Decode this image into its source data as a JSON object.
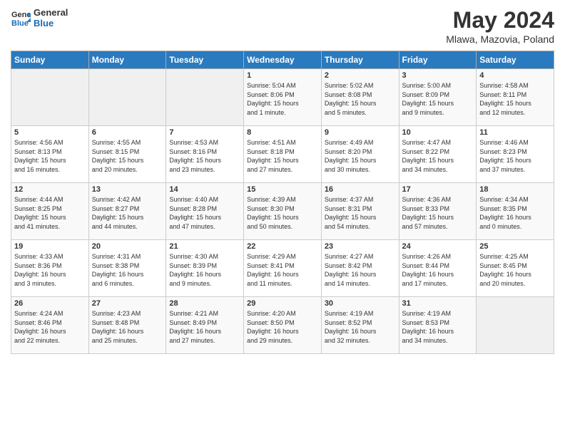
{
  "logo": {
    "line1": "General",
    "line2": "Blue"
  },
  "title": "May 2024",
  "subtitle": "Mlawa, Mazovia, Poland",
  "days_header": [
    "Sunday",
    "Monday",
    "Tuesday",
    "Wednesday",
    "Thursday",
    "Friday",
    "Saturday"
  ],
  "weeks": [
    [
      {
        "day": "",
        "info": ""
      },
      {
        "day": "",
        "info": ""
      },
      {
        "day": "",
        "info": ""
      },
      {
        "day": "1",
        "info": "Sunrise: 5:04 AM\nSunset: 8:06 PM\nDaylight: 15 hours\nand 1 minute."
      },
      {
        "day": "2",
        "info": "Sunrise: 5:02 AM\nSunset: 8:08 PM\nDaylight: 15 hours\nand 5 minutes."
      },
      {
        "day": "3",
        "info": "Sunrise: 5:00 AM\nSunset: 8:09 PM\nDaylight: 15 hours\nand 9 minutes."
      },
      {
        "day": "4",
        "info": "Sunrise: 4:58 AM\nSunset: 8:11 PM\nDaylight: 15 hours\nand 12 minutes."
      }
    ],
    [
      {
        "day": "5",
        "info": "Sunrise: 4:56 AM\nSunset: 8:13 PM\nDaylight: 15 hours\nand 16 minutes."
      },
      {
        "day": "6",
        "info": "Sunrise: 4:55 AM\nSunset: 8:15 PM\nDaylight: 15 hours\nand 20 minutes."
      },
      {
        "day": "7",
        "info": "Sunrise: 4:53 AM\nSunset: 8:16 PM\nDaylight: 15 hours\nand 23 minutes."
      },
      {
        "day": "8",
        "info": "Sunrise: 4:51 AM\nSunset: 8:18 PM\nDaylight: 15 hours\nand 27 minutes."
      },
      {
        "day": "9",
        "info": "Sunrise: 4:49 AM\nSunset: 8:20 PM\nDaylight: 15 hours\nand 30 minutes."
      },
      {
        "day": "10",
        "info": "Sunrise: 4:47 AM\nSunset: 8:22 PM\nDaylight: 15 hours\nand 34 minutes."
      },
      {
        "day": "11",
        "info": "Sunrise: 4:46 AM\nSunset: 8:23 PM\nDaylight: 15 hours\nand 37 minutes."
      }
    ],
    [
      {
        "day": "12",
        "info": "Sunrise: 4:44 AM\nSunset: 8:25 PM\nDaylight: 15 hours\nand 41 minutes."
      },
      {
        "day": "13",
        "info": "Sunrise: 4:42 AM\nSunset: 8:27 PM\nDaylight: 15 hours\nand 44 minutes."
      },
      {
        "day": "14",
        "info": "Sunrise: 4:40 AM\nSunset: 8:28 PM\nDaylight: 15 hours\nand 47 minutes."
      },
      {
        "day": "15",
        "info": "Sunrise: 4:39 AM\nSunset: 8:30 PM\nDaylight: 15 hours\nand 50 minutes."
      },
      {
        "day": "16",
        "info": "Sunrise: 4:37 AM\nSunset: 8:31 PM\nDaylight: 15 hours\nand 54 minutes."
      },
      {
        "day": "17",
        "info": "Sunrise: 4:36 AM\nSunset: 8:33 PM\nDaylight: 15 hours\nand 57 minutes."
      },
      {
        "day": "18",
        "info": "Sunrise: 4:34 AM\nSunset: 8:35 PM\nDaylight: 16 hours\nand 0 minutes."
      }
    ],
    [
      {
        "day": "19",
        "info": "Sunrise: 4:33 AM\nSunset: 8:36 PM\nDaylight: 16 hours\nand 3 minutes."
      },
      {
        "day": "20",
        "info": "Sunrise: 4:31 AM\nSunset: 8:38 PM\nDaylight: 16 hours\nand 6 minutes."
      },
      {
        "day": "21",
        "info": "Sunrise: 4:30 AM\nSunset: 8:39 PM\nDaylight: 16 hours\nand 9 minutes."
      },
      {
        "day": "22",
        "info": "Sunrise: 4:29 AM\nSunset: 8:41 PM\nDaylight: 16 hours\nand 11 minutes."
      },
      {
        "day": "23",
        "info": "Sunrise: 4:27 AM\nSunset: 8:42 PM\nDaylight: 16 hours\nand 14 minutes."
      },
      {
        "day": "24",
        "info": "Sunrise: 4:26 AM\nSunset: 8:44 PM\nDaylight: 16 hours\nand 17 minutes."
      },
      {
        "day": "25",
        "info": "Sunrise: 4:25 AM\nSunset: 8:45 PM\nDaylight: 16 hours\nand 20 minutes."
      }
    ],
    [
      {
        "day": "26",
        "info": "Sunrise: 4:24 AM\nSunset: 8:46 PM\nDaylight: 16 hours\nand 22 minutes."
      },
      {
        "day": "27",
        "info": "Sunrise: 4:23 AM\nSunset: 8:48 PM\nDaylight: 16 hours\nand 25 minutes."
      },
      {
        "day": "28",
        "info": "Sunrise: 4:21 AM\nSunset: 8:49 PM\nDaylight: 16 hours\nand 27 minutes."
      },
      {
        "day": "29",
        "info": "Sunrise: 4:20 AM\nSunset: 8:50 PM\nDaylight: 16 hours\nand 29 minutes."
      },
      {
        "day": "30",
        "info": "Sunrise: 4:19 AM\nSunset: 8:52 PM\nDaylight: 16 hours\nand 32 minutes."
      },
      {
        "day": "31",
        "info": "Sunrise: 4:19 AM\nSunset: 8:53 PM\nDaylight: 16 hours\nand 34 minutes."
      },
      {
        "day": "",
        "info": ""
      }
    ]
  ]
}
